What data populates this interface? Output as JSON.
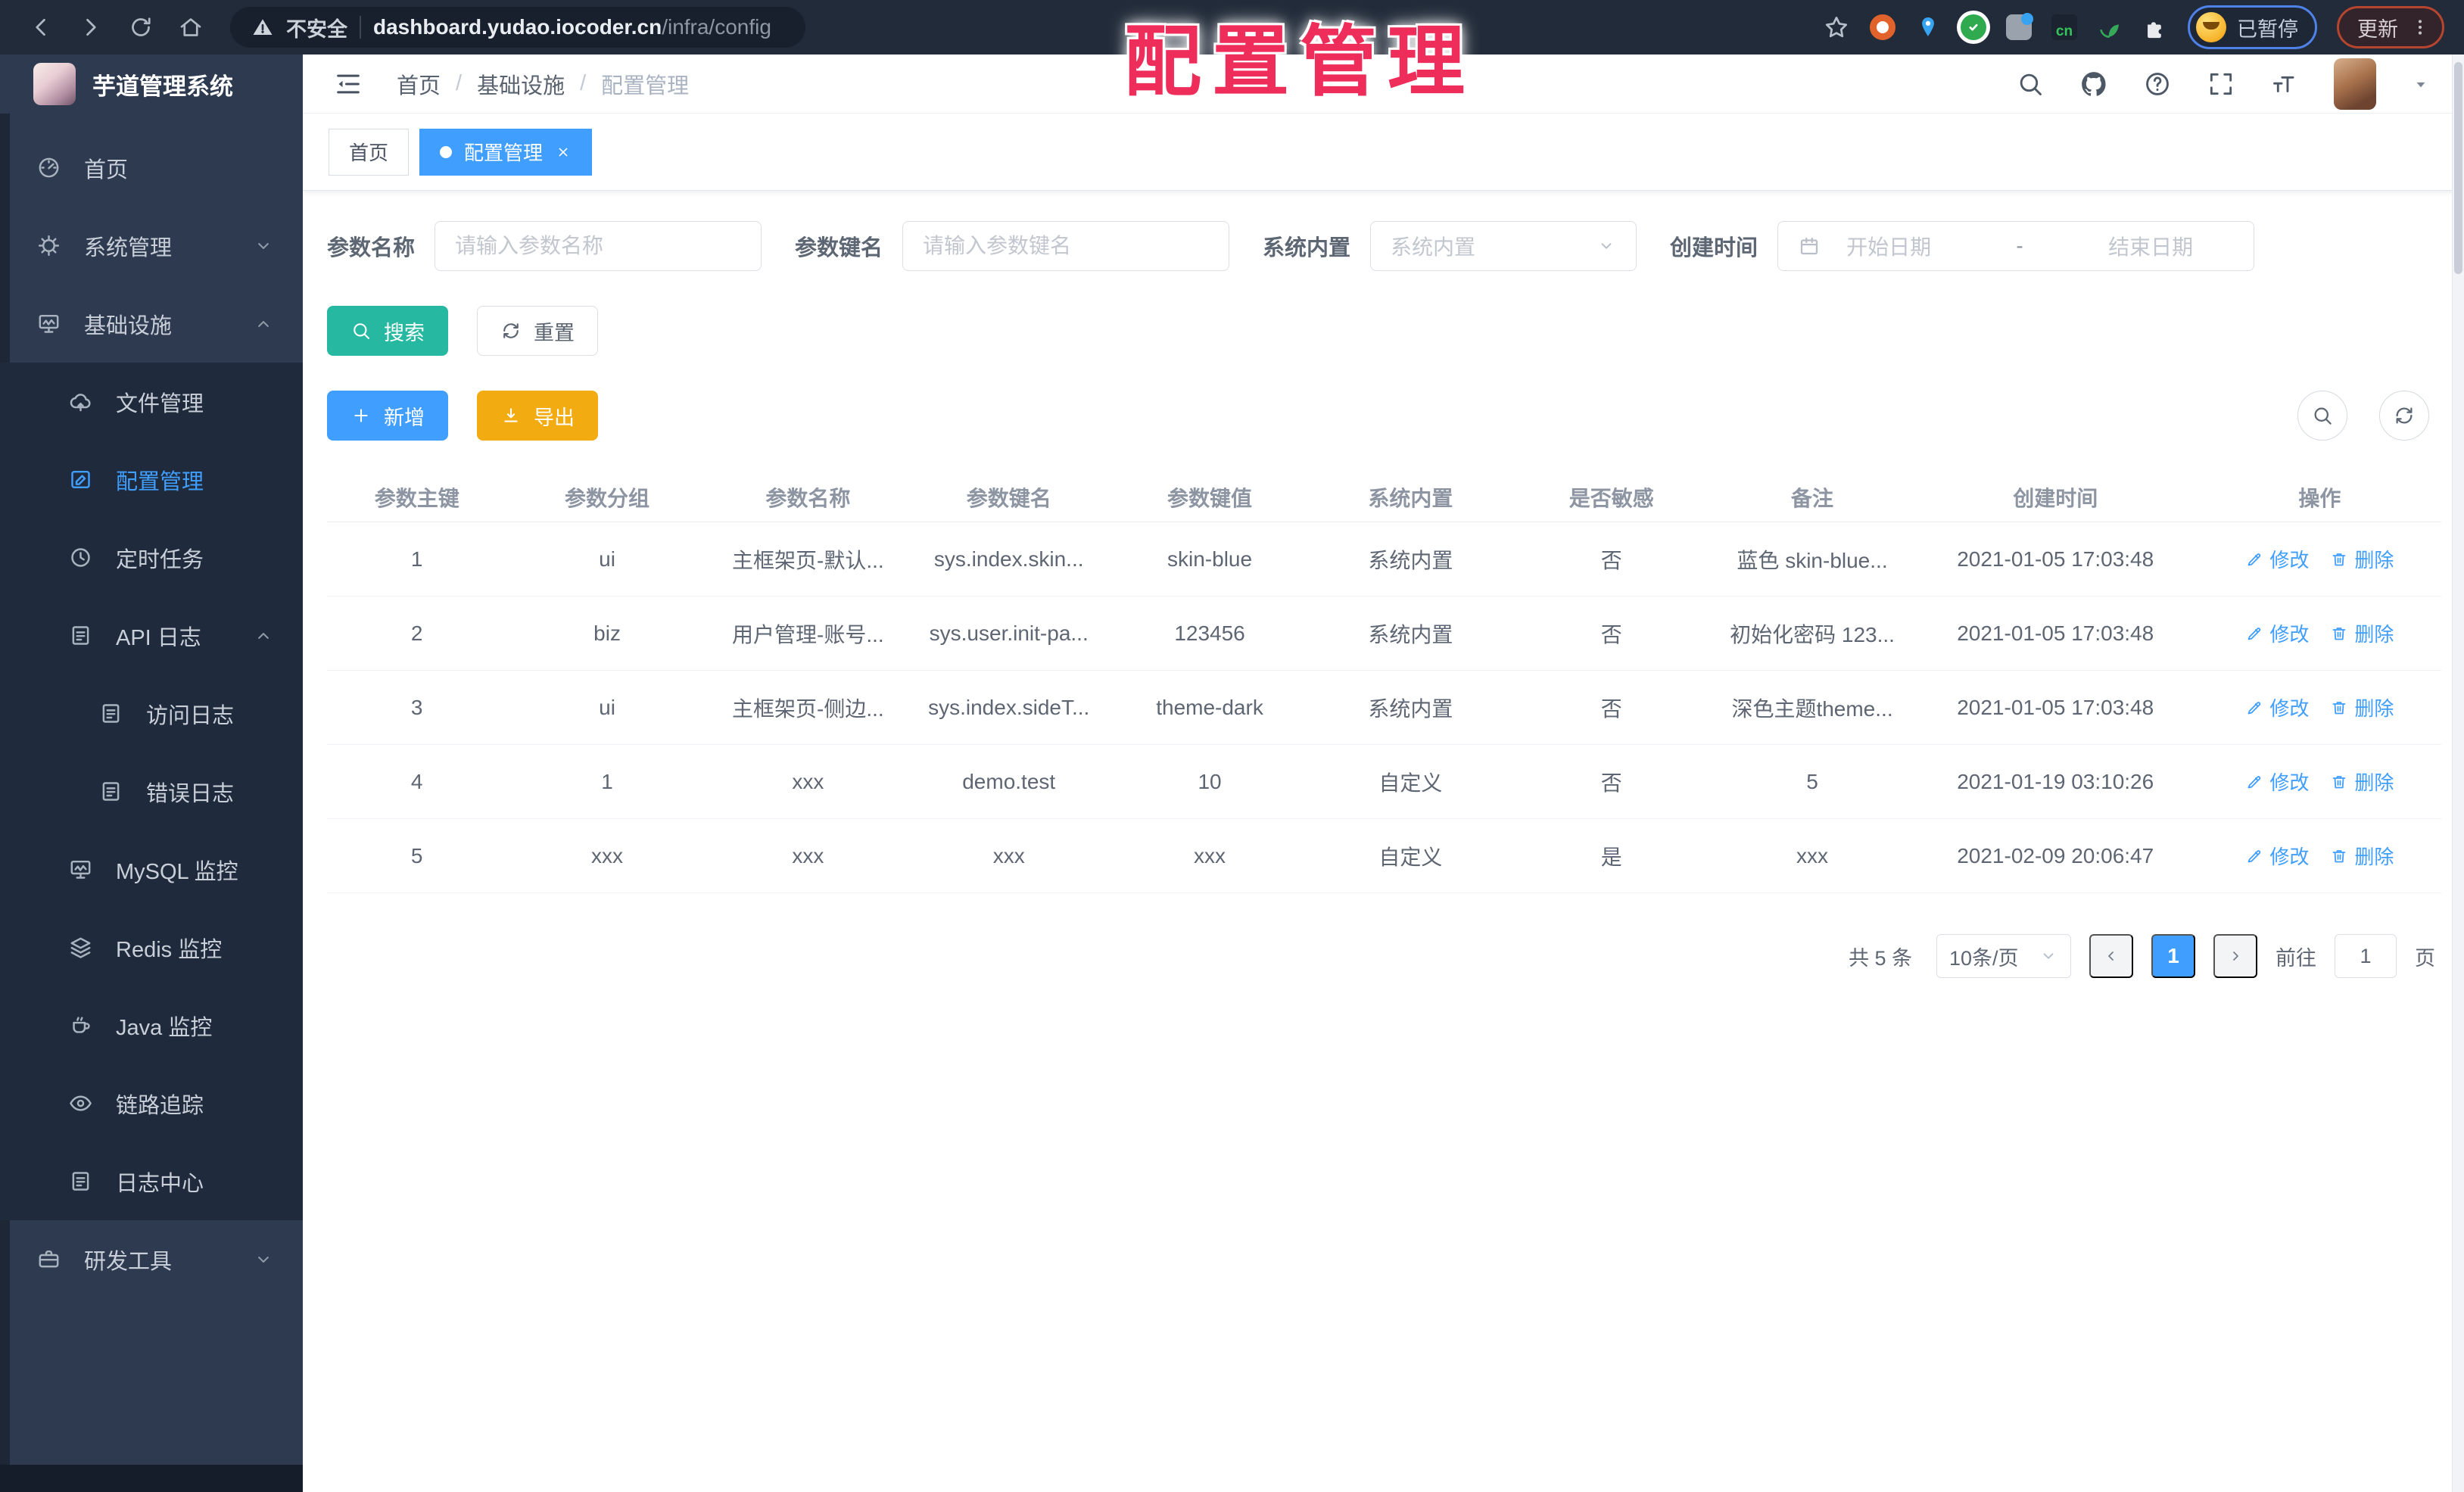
{
  "browser": {
    "security_label": "不安全",
    "url_domain": "dashboard.yudao.iocoder.cn",
    "url_path": "/infra/config",
    "ext_cn_label": "cn",
    "profile_label": "已暂停",
    "update_label": "更新"
  },
  "overlay": {
    "title": "配置管理"
  },
  "sidebar": {
    "logo_title": "芋道管理系统",
    "items": [
      {
        "label": "首页",
        "icon": "dashboard-icon",
        "depth": 0,
        "in_submenu": false,
        "active": false,
        "chevron": ""
      },
      {
        "label": "系统管理",
        "icon": "gear-icon",
        "depth": 0,
        "in_submenu": false,
        "active": false,
        "chevron": "down"
      },
      {
        "label": "基础设施",
        "icon": "monitor-icon",
        "depth": 0,
        "in_submenu": false,
        "active": false,
        "chevron": "up"
      },
      {
        "label": "文件管理",
        "icon": "cloud-upload-icon",
        "depth": 1,
        "in_submenu": true,
        "active": false,
        "chevron": ""
      },
      {
        "label": "配置管理",
        "icon": "edit-square-icon",
        "depth": 1,
        "in_submenu": true,
        "active": true,
        "chevron": ""
      },
      {
        "label": "定时任务",
        "icon": "timer-icon",
        "depth": 1,
        "in_submenu": true,
        "active": false,
        "chevron": ""
      },
      {
        "label": "API 日志",
        "icon": "log-icon",
        "depth": 1,
        "in_submenu": true,
        "active": false,
        "chevron": "up"
      },
      {
        "label": "访问日志",
        "icon": "log-icon",
        "depth": 2,
        "in_submenu": true,
        "active": false,
        "chevron": ""
      },
      {
        "label": "错误日志",
        "icon": "log-icon",
        "depth": 2,
        "in_submenu": true,
        "active": false,
        "chevron": ""
      },
      {
        "label": "MySQL 监控",
        "icon": "mysql-icon",
        "depth": 1,
        "in_submenu": true,
        "active": false,
        "chevron": ""
      },
      {
        "label": "Redis 监控",
        "icon": "redis-icon",
        "depth": 1,
        "in_submenu": true,
        "active": false,
        "chevron": ""
      },
      {
        "label": "Java 监控",
        "icon": "java-icon",
        "depth": 1,
        "in_submenu": true,
        "active": false,
        "chevron": ""
      },
      {
        "label": "链路追踪",
        "icon": "trace-eye-icon",
        "depth": 1,
        "in_submenu": true,
        "active": false,
        "chevron": ""
      },
      {
        "label": "日志中心",
        "icon": "log-icon",
        "depth": 1,
        "in_submenu": true,
        "active": false,
        "chevron": ""
      },
      {
        "label": "研发工具",
        "icon": "briefcase-icon",
        "depth": 0,
        "in_submenu": false,
        "active": false,
        "chevron": "down"
      }
    ]
  },
  "header": {
    "breadcrumb": [
      "首页",
      "基础设施",
      "配置管理"
    ]
  },
  "tabs": [
    {
      "label": "首页",
      "active": false
    },
    {
      "label": "配置管理",
      "active": true
    }
  ],
  "filters": {
    "name_label": "参数名称",
    "name_placeholder": "请输入参数名称",
    "key_label": "参数键名",
    "key_placeholder": "请输入参数键名",
    "type_label": "系统内置",
    "type_placeholder": "系统内置",
    "date_label": "创建时间",
    "date_start_placeholder": "开始日期",
    "date_separator": "-",
    "date_end_placeholder": "结束日期",
    "search_label": "搜索",
    "reset_label": "重置"
  },
  "toolbar": {
    "add_label": "新增",
    "export_label": "导出"
  },
  "table": {
    "columns": [
      "参数主键",
      "参数分组",
      "参数名称",
      "参数键名",
      "参数键值",
      "系统内置",
      "是否敏感",
      "备注",
      "创建时间",
      "操作"
    ],
    "action_edit": "修改",
    "action_delete": "删除",
    "rows": [
      {
        "id": "1",
        "group": "ui",
        "name": "主框架页-默认...",
        "key": "sys.index.skin...",
        "value": "skin-blue",
        "type": "系统内置",
        "sensitive": "否",
        "remark": "蓝色 skin-blue...",
        "created": "2021-01-05 17:03:48"
      },
      {
        "id": "2",
        "group": "biz",
        "name": "用户管理-账号...",
        "key": "sys.user.init-pa...",
        "value": "123456",
        "type": "系统内置",
        "sensitive": "否",
        "remark": "初始化密码 123...",
        "created": "2021-01-05 17:03:48"
      },
      {
        "id": "3",
        "group": "ui",
        "name": "主框架页-侧边...",
        "key": "sys.index.sideT...",
        "value": "theme-dark",
        "type": "系统内置",
        "sensitive": "否",
        "remark": "深色主题theme...",
        "created": "2021-01-05 17:03:48"
      },
      {
        "id": "4",
        "group": "1",
        "name": "xxx",
        "key": "demo.test",
        "value": "10",
        "type": "自定义",
        "sensitive": "否",
        "remark": "5",
        "created": "2021-01-19 03:10:26"
      },
      {
        "id": "5",
        "group": "xxx",
        "name": "xxx",
        "key": "xxx",
        "value": "xxx",
        "type": "自定义",
        "sensitive": "是",
        "remark": "xxx",
        "created": "2021-02-09 20:06:47"
      }
    ]
  },
  "pagination": {
    "total_label": "共 5 条",
    "page_size": "10条/页",
    "current_page": "1",
    "goto_label": "前往",
    "goto_value": "1",
    "page_unit": "页"
  },
  "colors": {
    "accent_blue": "#409eff",
    "teal": "#27b8a1",
    "amber": "#f3ab12",
    "overlay_pink": "#ee2d5b",
    "sidebar": "#2d3a4f",
    "submenu": "#1f2a3c"
  }
}
